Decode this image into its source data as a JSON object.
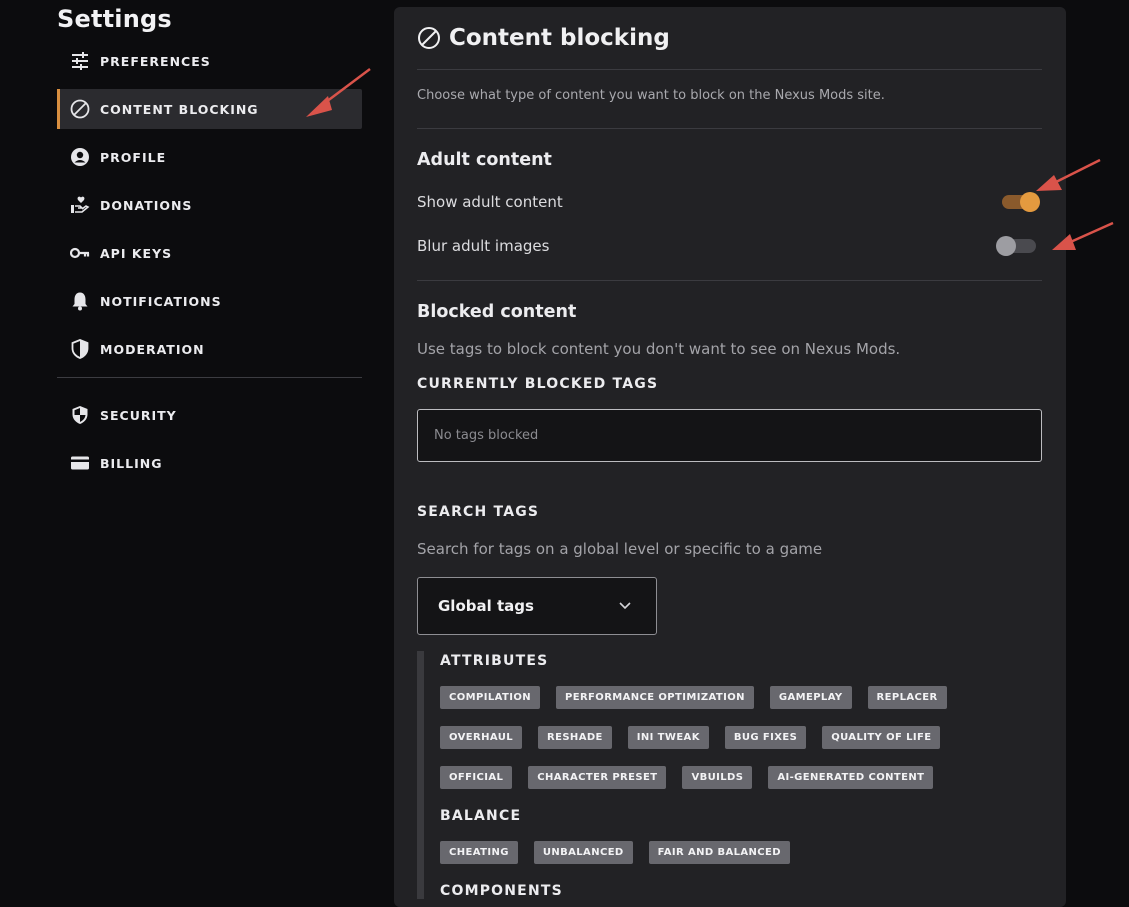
{
  "sidebar": {
    "title": "Settings",
    "items": [
      {
        "label": "PREFERENCES",
        "icon": "sliders-icon"
      },
      {
        "label": "CONTENT BLOCKING",
        "icon": "block-icon",
        "active": true
      },
      {
        "label": "PROFILE",
        "icon": "user-icon"
      },
      {
        "label": "DONATIONS",
        "icon": "hand-heart-icon"
      },
      {
        "label": "API KEYS",
        "icon": "key-icon"
      },
      {
        "label": "NOTIFICATIONS",
        "icon": "bell-icon"
      },
      {
        "label": "MODERATION",
        "icon": "shield-half-icon"
      }
    ],
    "secondary": [
      {
        "label": "SECURITY",
        "icon": "shield-check-icon"
      },
      {
        "label": "BILLING",
        "icon": "credit-card-icon"
      }
    ]
  },
  "panel": {
    "title": "Content blocking",
    "description": "Choose what type of content you want to block on the Nexus Mods site.",
    "adult": {
      "heading": "Adult content",
      "show_label": "Show adult content",
      "show_on": true,
      "blur_label": "Blur adult images",
      "blur_on": false
    },
    "blocked": {
      "heading": "Blocked content",
      "description": "Use tags to block content you don't want to see on Nexus Mods.",
      "current_heading": "CURRENTLY BLOCKED TAGS",
      "empty_text": "No tags blocked"
    },
    "search": {
      "heading": "SEARCH TAGS",
      "description": "Search for tags on a global level or specific to a game",
      "select_value": "Global tags",
      "groups": [
        {
          "name": "ATTRIBUTES",
          "tags": [
            "COMPILATION",
            "PERFORMANCE OPTIMIZATION",
            "GAMEPLAY",
            "REPLACER",
            "OVERHAUL",
            "RESHADE",
            "INI TWEAK",
            "BUG FIXES",
            "QUALITY OF LIFE",
            "OFFICIAL",
            "CHARACTER PRESET",
            "VBUILDS",
            "AI-GENERATED CONTENT"
          ]
        },
        {
          "name": "BALANCE",
          "tags": [
            "CHEATING",
            "UNBALANCED",
            "FAIR AND BALANCED"
          ]
        },
        {
          "name": "COMPONENTS",
          "tags": []
        }
      ]
    }
  },
  "colors": {
    "accent": "#d98f40",
    "panel": "#222225",
    "background": "#0c0c0e",
    "annotation": "#d9534a"
  }
}
